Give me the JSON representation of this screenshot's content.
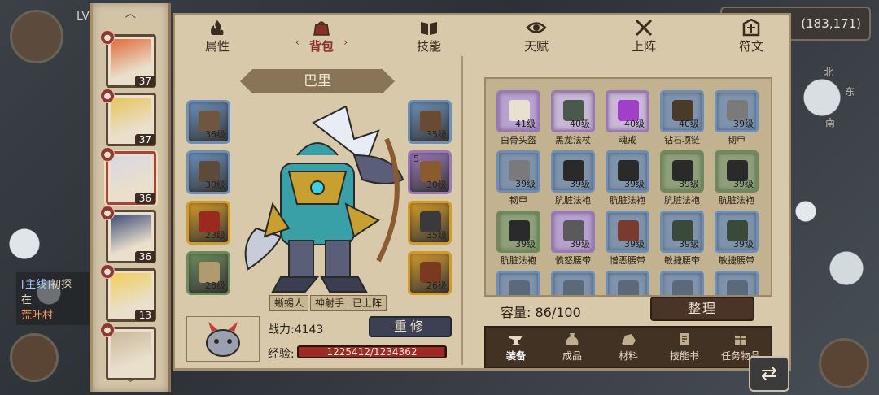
{
  "map": {
    "player_level_label": "LV",
    "coords": "(183,171)",
    "quest_tag": "[主线]",
    "quest_title": "初探",
    "quest_line1": "在",
    "quest_highlight": "荒叶村",
    "compass_north": "北",
    "compass_east": "东",
    "compass_south": "南"
  },
  "hero_strip": {
    "up_arrow": "︿",
    "down_arrow": "﹀",
    "heroes": [
      {
        "level": "37",
        "badge": "●",
        "color": "#e06b3a"
      },
      {
        "level": "37",
        "badge": "●",
        "color": "#e8c45a"
      },
      {
        "level": "36",
        "badge": "●",
        "color": "#d8d8e4"
      },
      {
        "level": "36",
        "badge": "●",
        "color": "#3d4c78"
      },
      {
        "level": "13",
        "badge": "●",
        "color": "#f0cf5a"
      },
      {
        "level": "",
        "badge": "●",
        "color": "#c9b89a"
      }
    ]
  },
  "tabs": [
    {
      "label": "属性",
      "icon": "flame-icon"
    },
    {
      "label": "背包",
      "icon": "bag-icon"
    },
    {
      "label": "技能",
      "icon": "book-icon"
    },
    {
      "label": "天赋",
      "icon": "eye-icon"
    },
    {
      "label": "上阵",
      "icon": "swords-icon"
    },
    {
      "label": "符文",
      "icon": "rune-icon"
    }
  ],
  "active_tab_side_left": "‹",
  "active_tab_side_right": "›",
  "hero": {
    "name": "巴里",
    "tags": [
      "蜥蜴人",
      "神射手",
      "已上阵"
    ],
    "power_label": "战力:",
    "power_value": "4143",
    "repair_label": "重修",
    "exp_label": "经验:",
    "exp_text": "1225412/1234362",
    "exp_fraction": 0.9927
  },
  "equipment": {
    "left": [
      {
        "level": "36级",
        "tier": "",
        "frame": "#6b8fb8",
        "item": "#6e5640"
      },
      {
        "level": "30级",
        "tier": "",
        "frame": "#6b8fb8",
        "item": "#5c4a3a"
      },
      {
        "level": "23级",
        "tier": "",
        "frame": "#d19a2a",
        "item": "#9a2a20"
      },
      {
        "level": "28级",
        "tier": "",
        "frame": "#6e8a5a",
        "item": "#b09a70"
      }
    ],
    "right": [
      {
        "level": "35级",
        "tier": "",
        "frame": "#6b8fb8",
        "item": "#6b4a32"
      },
      {
        "level": "30级",
        "tier": "5",
        "frame": "#9a78b8",
        "item": "#8a5a30"
      },
      {
        "level": "35级",
        "tier": "",
        "frame": "#d19a2a",
        "item": "#3a3a3a"
      },
      {
        "level": "26级",
        "tier": "",
        "frame": "#d19a2a",
        "item": "#7a3a20"
      }
    ]
  },
  "inventory": {
    "items": [
      {
        "name": "白骨头盔",
        "level": "41级",
        "frame": "#9a78b8",
        "bg": "#b8a0d0",
        "item": "#e8e0d0"
      },
      {
        "name": "黑龙法杖",
        "level": "40级",
        "frame": "#9a78b8",
        "bg": "#c9b6d8",
        "item": "#4a5a4a"
      },
      {
        "name": "魂戒",
        "level": "40级",
        "frame": "#9a78b8",
        "bg": "#c9b6d8",
        "item": "#a040c8"
      },
      {
        "name": "钻石项链",
        "level": "40级",
        "frame": "#6b8fb8",
        "bg": "#7e93ad",
        "item": "#4a3a2a"
      },
      {
        "name": "韧甲",
        "level": "39级",
        "frame": "#6b8fb8",
        "bg": "#7e93ad",
        "item": "#7a7a7a"
      },
      {
        "name": "韧甲",
        "level": "39级",
        "frame": "#6b8fb8",
        "bg": "#7e93ad",
        "item": "#7a7a7a"
      },
      {
        "name": "肮脏法袍",
        "level": "39级",
        "frame": "#6b8fb8",
        "bg": "#7e93ad",
        "item": "#2a2a2a"
      },
      {
        "name": "肮脏法袍",
        "level": "39级",
        "frame": "#6b8fb8",
        "bg": "#7e93ad",
        "item": "#2a2a2a"
      },
      {
        "name": "肮脏法袍",
        "level": "39级",
        "frame": "#6e8a5a",
        "bg": "#8ea07a",
        "item": "#2a2a2a"
      },
      {
        "name": "肮脏法袍",
        "level": "39级",
        "frame": "#6e8a5a",
        "bg": "#8ea07a",
        "item": "#2a2a2a"
      },
      {
        "name": "肮脏法袍",
        "level": "39级",
        "frame": "#6e8a5a",
        "bg": "#8ea07a",
        "item": "#2a2a2a"
      },
      {
        "name": "愤怒腰带",
        "level": "39级",
        "frame": "#9a78b8",
        "bg": "#b8a0d0",
        "item": "#5a5a5a"
      },
      {
        "name": "憎恶腰带",
        "level": "39级",
        "frame": "#6b8fb8",
        "bg": "#7e93ad",
        "item": "#7a3a30"
      },
      {
        "name": "敏捷腰带",
        "level": "39级",
        "frame": "#6b8fb8",
        "bg": "#7e93ad",
        "item": "#3a4a3a"
      },
      {
        "name": "敏捷腰带",
        "level": "39级",
        "frame": "#6b8fb8",
        "bg": "#7e93ad",
        "item": "#3a4a3a"
      },
      {
        "name": "",
        "level": "",
        "frame": "#6b8fb8",
        "bg": "#7e93ad",
        "item": "#5a6a7a"
      },
      {
        "name": "",
        "level": "",
        "frame": "#6b8fb8",
        "bg": "#7e93ad",
        "item": "#5a6a7a"
      },
      {
        "name": "",
        "level": "",
        "frame": "#6b8fb8",
        "bg": "#7e93ad",
        "item": "#5a6a7a"
      },
      {
        "name": "",
        "level": "",
        "frame": "#6b8fb8",
        "bg": "#7e93ad",
        "item": "#5a6a7a"
      },
      {
        "name": "",
        "level": "",
        "frame": "#6b8fb8",
        "bg": "#7e93ad",
        "item": "#5a6a7a"
      }
    ],
    "capacity_label": "容量:",
    "capacity_value": "86/100",
    "sort_label": "整理"
  },
  "categories": [
    {
      "label": "装备",
      "icon": "anvil-icon"
    },
    {
      "label": "成品",
      "icon": "sack-icon"
    },
    {
      "label": "材料",
      "icon": "ore-icon"
    },
    {
      "label": "技能书",
      "icon": "scroll-icon"
    },
    {
      "label": "任务物品",
      "icon": "bundle-icon"
    }
  ],
  "return_glyph": "⇄"
}
